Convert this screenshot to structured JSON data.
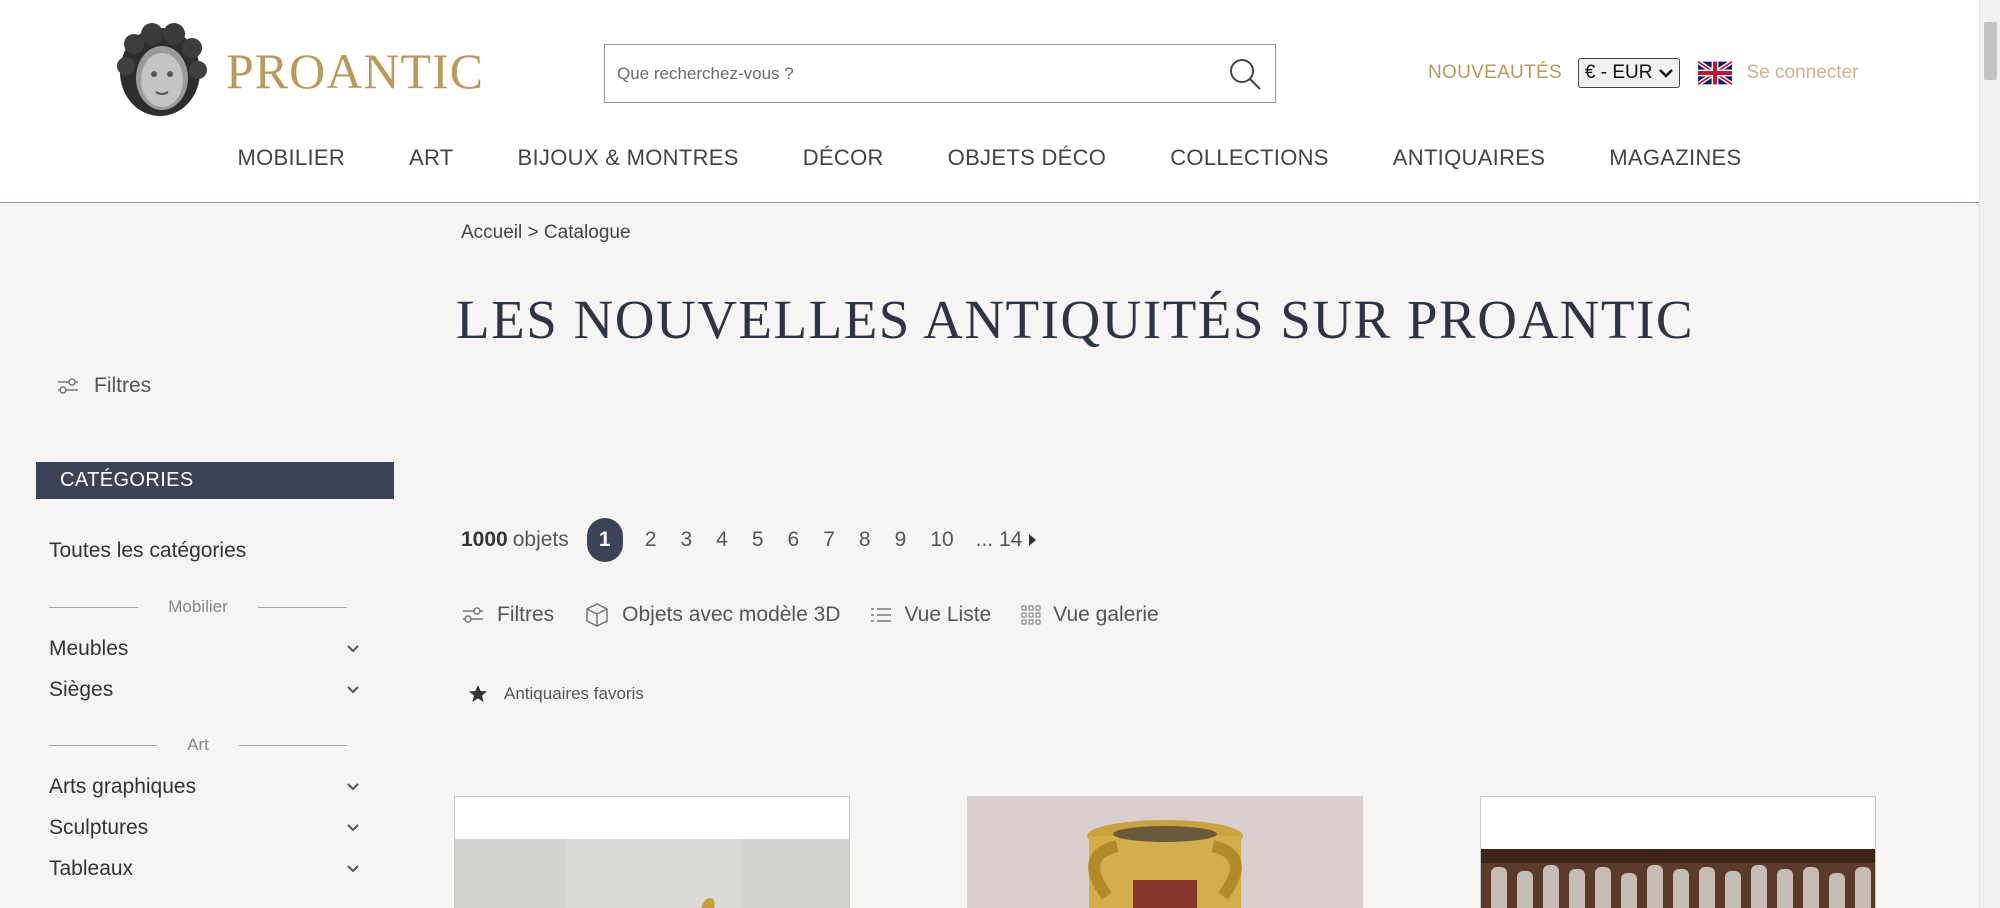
{
  "header": {
    "brand": "PROANTIC",
    "search_placeholder": "Que recherchez-vous ?",
    "nouveautes": "NOUVEAUTÉS",
    "currency": "€ - EUR",
    "login": "Se connecter"
  },
  "nav": [
    "MOBILIER",
    "ART",
    "BIJOUX & MONTRES",
    "DÉCOR",
    "OBJETS DÉCO",
    "COLLECTIONS",
    "ANTIQUAIRES",
    "MAGAZINES"
  ],
  "breadcrumb": "Accueil > Catalogue",
  "page_title": "LES NOUVELLES ANTIQUITÉS SUR PROANTIC",
  "sidebar": {
    "filters_label": "Filtres",
    "categories_header": "CATÉGORIES",
    "all_categories": "Toutes les catégories",
    "groups": [
      {
        "label": "Mobilier",
        "items": [
          "Meubles",
          "Sièges"
        ]
      },
      {
        "label": "Art",
        "items": [
          "Arts graphiques",
          "Sculptures",
          "Tableaux"
        ]
      }
    ]
  },
  "pagination": {
    "count": "1000",
    "count_label": "objets",
    "current": "1",
    "pages": [
      "2",
      "3",
      "4",
      "5",
      "6",
      "7",
      "8",
      "9",
      "10"
    ],
    "ellipsis_last": "... 14"
  },
  "toolbar": {
    "filters": "Filtres",
    "models_3d": "Objets avec modèle 3D",
    "list_view": "Vue Liste",
    "gallery_view": "Vue galerie"
  },
  "favorites_label": "Antiquaires favoris",
  "colors": {
    "gold": "#b89a5a",
    "navy": "#3a4456",
    "background": "#f6f5f3"
  }
}
